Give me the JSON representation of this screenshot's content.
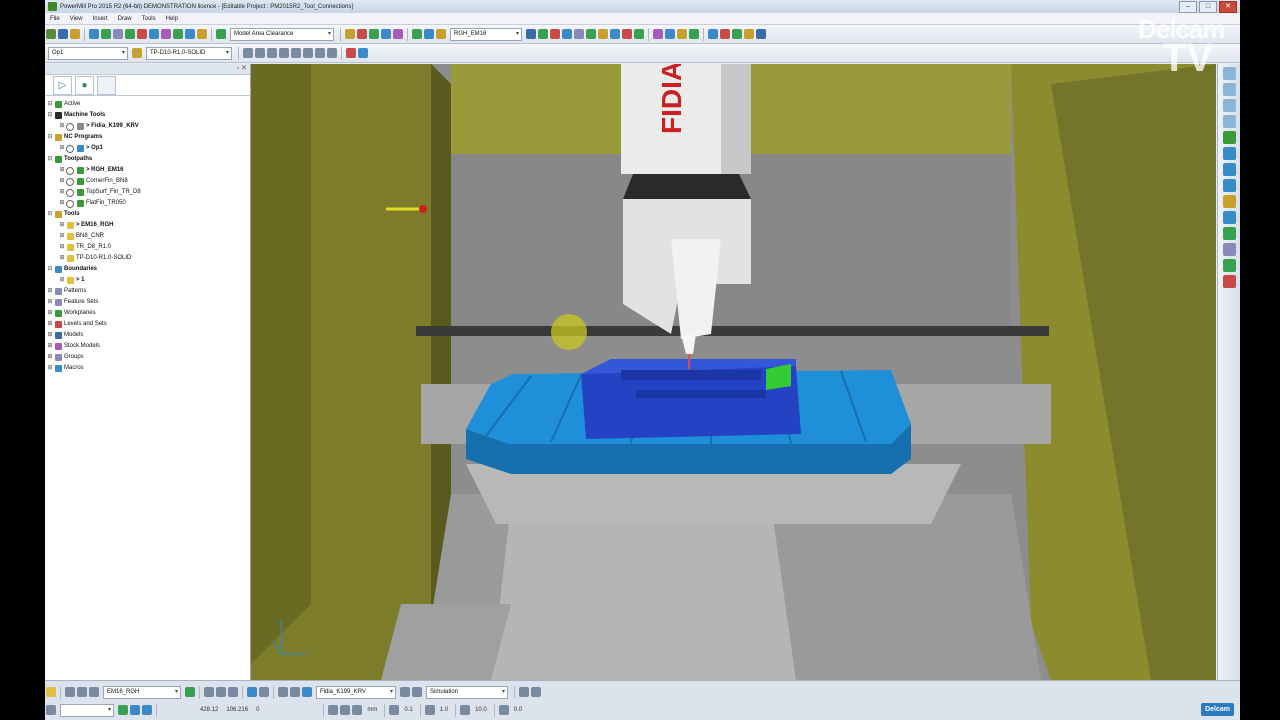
{
  "window": {
    "title": "PowerMill Pro 2015 R2 (64-bit) DEMONSTRATION licence - [Editable Project : PM2015R2_Tool_Connections]"
  },
  "menu": [
    "File",
    "View",
    "Insert",
    "Draw",
    "Tools",
    "Help"
  ],
  "toolbar1": {
    "clearance_combo": "Model Area Clearance",
    "tool_combo": "RGH_EM16"
  },
  "toolbar2": {
    "program_combo": "Op1",
    "toolpath_combo": "TP-D10-R1.0-SOLID"
  },
  "tree": {
    "active": "Active",
    "machine_tools": "Machine Tools",
    "machine": "> Fidia_K199_KRV",
    "nc_programs": "NC Programs",
    "nc_op": "> Op1",
    "toolpaths": "Toolpaths",
    "tp1": "> RGH_EM16",
    "tp2": "CornerFin_BN8",
    "tp3": "TopSurf_Fin_TR_D8",
    "tp4": "FlatFin_TR050",
    "tools": "Tools",
    "tool1": "> EM16_RGH",
    "tool2": "BN8_CNR",
    "tool3": "TR_D8_R1.0",
    "tool4": "TP-D10-R1.0-SOLID",
    "boundaries": "Boundaries",
    "boundary1": "> 1",
    "patterns": "Patterns",
    "feature_sets": "Feature Sets",
    "workplanes": "Workplanes",
    "levels": "Levels and Sets",
    "models": "Models",
    "stock_models": "Stock Models",
    "groups": "Groups",
    "macros": "Macros"
  },
  "statusbar": {
    "tool_combo": "EM16_RGH",
    "machine_combo": "Fidia_K199_KRV",
    "mode_combo": "Simulation",
    "coord_x": "428.12",
    "coord_y": "106.216",
    "coord_z": "0",
    "units": "mm",
    "tol": "0.1",
    "thickness": "1.0",
    "stepover": "10.0",
    "stepdown": "0.0",
    "logo": "Delcam"
  },
  "watermark": {
    "line1": "Delcam",
    "line2": "TV"
  },
  "viewport": {
    "spindle_text": "FIDIA"
  },
  "colors": {
    "enclosure": "#8c8c2e",
    "table": "#1e8fd8",
    "part": "#2343c4",
    "machine": "#b4b4b4",
    "spindle": "#ebebeb",
    "accent": "#cc2020"
  }
}
